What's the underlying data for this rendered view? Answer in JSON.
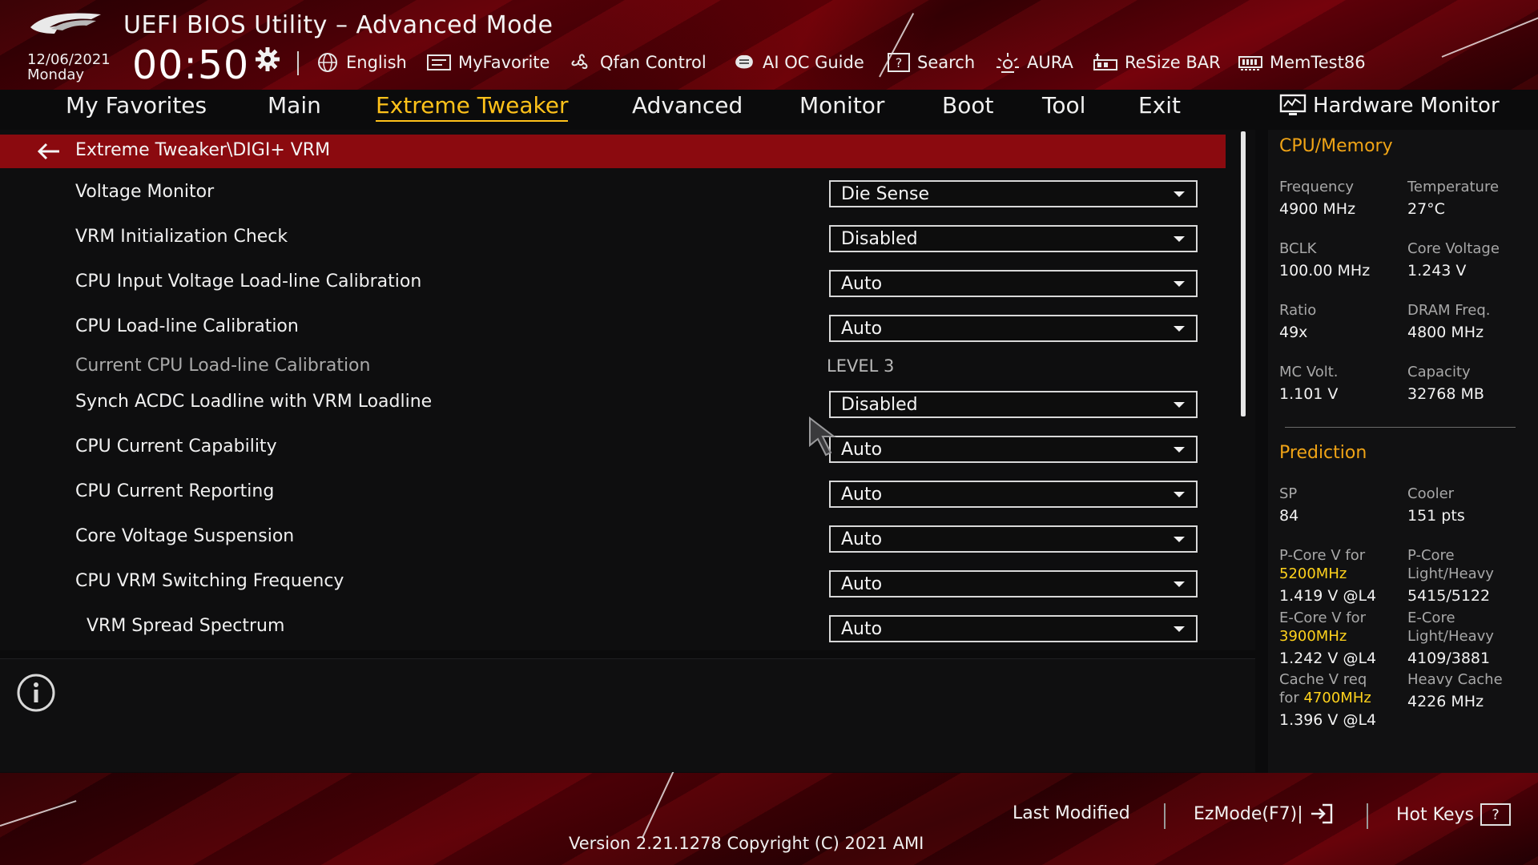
{
  "header": {
    "title": "UEFI BIOS Utility – Advanced Mode",
    "date": "12/06/2021",
    "weekday": "Monday",
    "time": "00:50"
  },
  "toolbar": [
    {
      "label": "English",
      "icon": "globe-icon"
    },
    {
      "label": "MyFavorite",
      "icon": "favorite-icon"
    },
    {
      "label": "Qfan Control",
      "icon": "fan-icon"
    },
    {
      "label": "AI OC Guide",
      "icon": "ai-icon"
    },
    {
      "label": "Search",
      "icon": "search-icon"
    },
    {
      "label": "AURA",
      "icon": "aura-icon"
    },
    {
      "label": "ReSize BAR",
      "icon": "resize-bar-icon"
    },
    {
      "label": "MemTest86",
      "icon": "memtest-icon"
    }
  ],
  "menu": {
    "items": [
      "My Favorites",
      "Main",
      "Extreme Tweaker",
      "Advanced",
      "Monitor",
      "Boot",
      "Tool",
      "Exit"
    ],
    "active": "Extreme Tweaker"
  },
  "breadcrumb": "Extreme Tweaker\\DIGI+ VRM",
  "settings": [
    {
      "label": "Voltage Monitor",
      "value": "Die Sense"
    },
    {
      "label": "VRM Initialization Check",
      "value": "Disabled"
    },
    {
      "label": "CPU Input Voltage Load-line Calibration",
      "value": "Auto"
    },
    {
      "label": "CPU Load-line Calibration",
      "value": "Auto"
    },
    {
      "label": "Current CPU Load-line Calibration",
      "value": "LEVEL 3"
    },
    {
      "label": "Synch ACDC Loadline with VRM Loadline",
      "value": "Disabled"
    },
    {
      "label": "CPU Current Capability",
      "value": "Auto"
    },
    {
      "label": "CPU Current Reporting",
      "value": "Auto"
    },
    {
      "label": "Core Voltage Suspension",
      "value": "Auto"
    },
    {
      "label": "CPU VRM Switching Frequency",
      "value": "Auto"
    },
    {
      "label": "VRM Spread Spectrum",
      "value": "Auto"
    }
  ],
  "hw_monitor": {
    "title": "Hardware Monitor",
    "cpu_memory": {
      "heading": "CPU/Memory",
      "frequency": {
        "label": "Frequency",
        "value": "4900 MHz"
      },
      "temperature": {
        "label": "Temperature",
        "value": "27°C"
      },
      "bclk": {
        "label": "BCLK",
        "value": "100.00 MHz"
      },
      "core_voltage": {
        "label": "Core Voltage",
        "value": "1.243 V"
      },
      "ratio": {
        "label": "Ratio",
        "value": "49x"
      },
      "dram_freq": {
        "label": "DRAM Freq.",
        "value": "4800 MHz"
      },
      "mc_volt": {
        "label": "MC Volt.",
        "value": "1.101 V"
      },
      "capacity": {
        "label": "Capacity",
        "value": "32768 MB"
      }
    },
    "prediction": {
      "heading": "Prediction",
      "sp": {
        "label": "SP",
        "value": "84"
      },
      "cooler": {
        "label": "Cooler",
        "value": "151 pts"
      },
      "pcore_v": {
        "label": "P-Core V for",
        "freq": "5200MHz",
        "value": "1.419 V @L4"
      },
      "pcore_lh": {
        "label_1": "P-Core",
        "label_2": "Light/Heavy",
        "value": "5415/5122"
      },
      "ecore_v": {
        "label": "E-Core V for",
        "freq": "3900MHz",
        "value": "1.242 V @L4"
      },
      "ecore_lh": {
        "label_1": "E-Core",
        "label_2": "Light/Heavy",
        "value": "4109/3881"
      },
      "cache_v": {
        "label_1": "Cache V req",
        "label_2": "for",
        "freq": "4700MHz",
        "value": "1.396 V @L4"
      },
      "heavy_cache": {
        "label": "Heavy Cache",
        "value": "4226 MHz"
      }
    }
  },
  "footer": {
    "last_modified": "Last Modified",
    "ezmode": "EzMode(F7)|",
    "hotkeys": "Hot Keys",
    "hotkeys_key": "?",
    "version": "Version 2.21.1278 Copyright (C) 2021 AMI"
  },
  "colors": {
    "accent": "#ffc21a",
    "breadcrumb_bg": "#8b0a0f",
    "section_heading": "#f0a416",
    "prediction_freq": "#ffd21c"
  }
}
